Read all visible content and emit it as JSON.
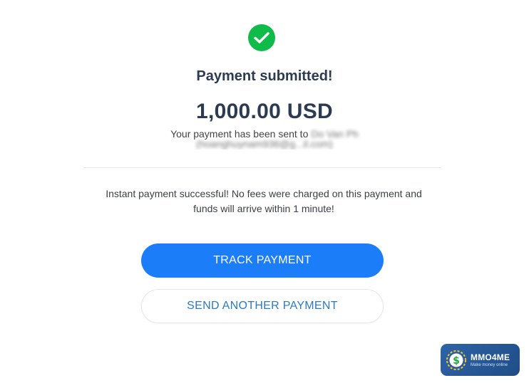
{
  "status": {
    "icon": "checkmark-circle-icon",
    "title": "Payment submitted!",
    "color": "#0fbc4a"
  },
  "payment": {
    "amount": "1,000.00 USD",
    "sent_prefix": "Your payment has been sent to",
    "recipient_name": "Do Van Ph",
    "recipient_email": "(hoanghuynam936@g...il.com)"
  },
  "info": {
    "line1": "Instant payment successful! No fees were charged on this payment and",
    "line2": "funds will arrive within 1 minute!"
  },
  "actions": {
    "track_label": "TRACK PAYMENT",
    "send_another_label": "SEND ANOTHER PAYMENT",
    "primary_color": "#1b7ef8"
  },
  "watermark": {
    "icon": "dollar-coin-icon",
    "brand": "MMO4ME",
    "tagline": "Make money online"
  }
}
